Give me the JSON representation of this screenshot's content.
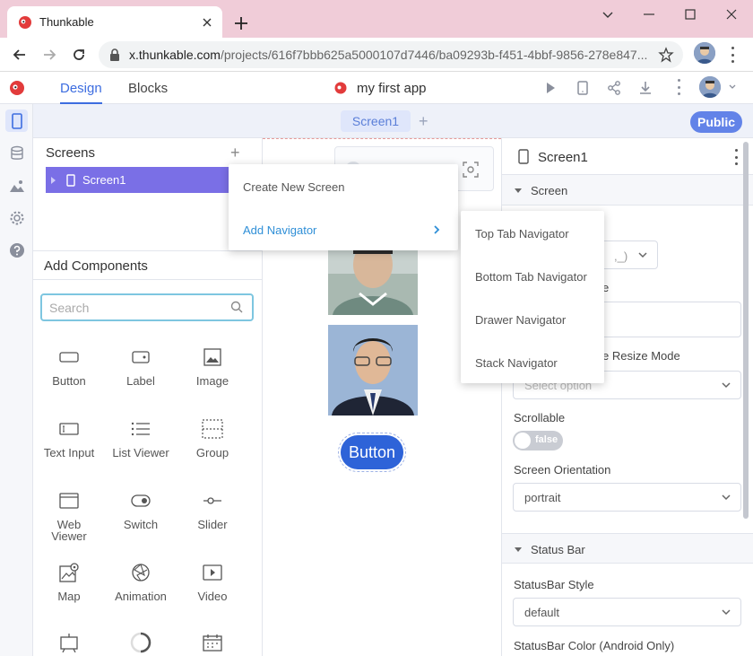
{
  "browser": {
    "tab_title": "Thunkable",
    "url_host": "x.thunkable.com",
    "url_path": "/projects/616f7bbb625a5000107d7446/ba09293b-f451-4bbf-9856-278e847..."
  },
  "app_header": {
    "tabs": [
      {
        "label": "Design",
        "active": true
      },
      {
        "label": "Blocks",
        "active": false
      }
    ],
    "project_name": "my first app"
  },
  "screen_bar": {
    "active_screen": "Screen1",
    "public_label": "Public"
  },
  "screens_panel": {
    "title": "Screens",
    "items": [
      {
        "label": "Screen1"
      }
    ]
  },
  "components_panel": {
    "title": "Add Components",
    "search_placeholder": "Search",
    "components": [
      {
        "label": "Button",
        "icon": "button-icon"
      },
      {
        "label": "Label",
        "icon": "label-icon"
      },
      {
        "label": "Image",
        "icon": "image-icon"
      },
      {
        "label": "Text Input",
        "icon": "text-input-icon"
      },
      {
        "label": "List Viewer",
        "icon": "list-icon"
      },
      {
        "label": "Group",
        "icon": "group-icon"
      },
      {
        "label": "Web\nViewer",
        "icon": "web-viewer-icon"
      },
      {
        "label": "Switch",
        "icon": "switch-icon"
      },
      {
        "label": "Slider",
        "icon": "slider-icon"
      },
      {
        "label": "Map",
        "icon": "map-icon"
      },
      {
        "label": "Animation",
        "icon": "animation-icon"
      },
      {
        "label": "Video",
        "icon": "video-icon"
      }
    ]
  },
  "canvas": {
    "button_label": "Button"
  },
  "context_menu": {
    "items": [
      {
        "label": "Create New Screen"
      },
      {
        "label": "Add Navigator",
        "has_submenu": true
      }
    ],
    "submenu": [
      {
        "label": "Top Tab Navigator"
      },
      {
        "label": "Bottom Tab Navigator"
      },
      {
        "label": "Drawer Navigator"
      },
      {
        "label": "Stack Navigator"
      }
    ]
  },
  "properties_panel": {
    "title": "Screen1",
    "section_screen": "Screen",
    "partial_label_image": "e",
    "partial_label_resize": "e Resize Mode",
    "partial_select_value": ",_)",
    "resize_mode_placeholder": "Select option",
    "scrollable_label": "Scrollable",
    "scrollable_value": "false",
    "orientation_label": "Screen Orientation",
    "orientation_value": "portrait",
    "section_status_bar": "Status Bar",
    "statusbar_style_label": "StatusBar Style",
    "statusbar_style_value": "default",
    "statusbar_color_label": "StatusBar Color (Android Only)"
  },
  "colors": {
    "accent": "#3d6de0",
    "screen_row": "#7a6fe6",
    "app_button": "#2e63d8",
    "tab_strip": "#f0ccd8"
  }
}
